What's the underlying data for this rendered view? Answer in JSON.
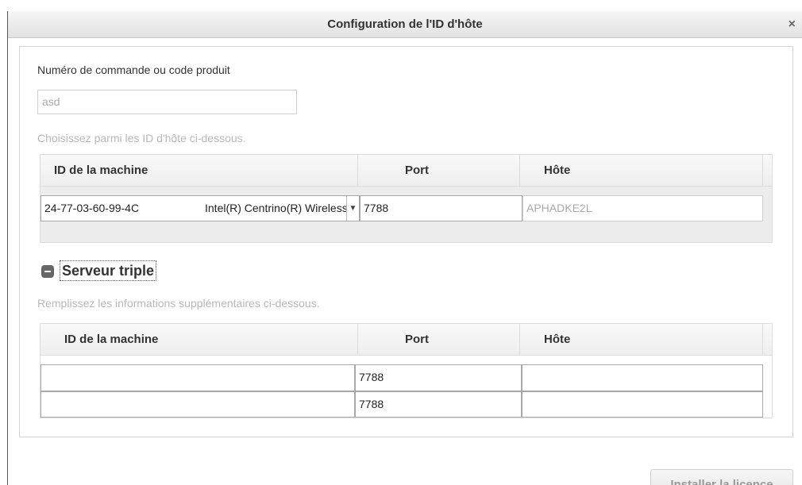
{
  "dialog": {
    "title": "Configuration de l'ID d'hôte",
    "close_glyph": "×"
  },
  "order": {
    "label": "Numéro de commande ou code produit",
    "value": "asd"
  },
  "hostids": {
    "hint": "Choisissez parmi les ID d'hôte ci-dessous.",
    "columns": [
      "ID de la machine",
      "Port",
      "Hôte"
    ],
    "row": {
      "machine_id": "24-77-03-60-99-4C",
      "adapter": "Intel(R) Centrino(R) Wireless-N",
      "port": "7788",
      "host": "APHADKE2L"
    }
  },
  "triple": {
    "title": "Serveur triple",
    "hint": "Remplissez les informations supplémentaires ci-dessous.",
    "columns": [
      "ID de la machine",
      "Port",
      "Hôte"
    ],
    "rows": [
      {
        "machine_id": "",
        "port": "7788",
        "host": ""
      },
      {
        "machine_id": "",
        "port": "7788",
        "host": ""
      }
    ]
  },
  "footer": {
    "install_label": "Installer la licence"
  },
  "icons": {
    "dropdown": "triangle-down-icon",
    "collapse": "minus-icon"
  }
}
